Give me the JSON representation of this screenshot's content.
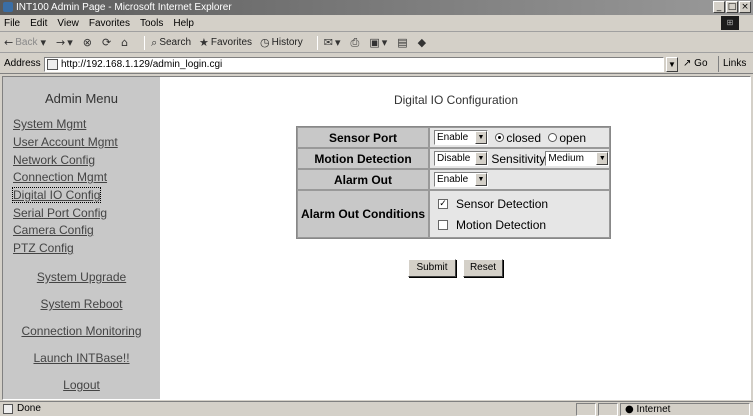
{
  "window": {
    "title": "INT100 Admin Page - Microsoft Internet Explorer",
    "controls": [
      "_",
      "□",
      "×"
    ]
  },
  "menubar": [
    "File",
    "Edit",
    "View",
    "Favorites",
    "Tools",
    "Help"
  ],
  "toolbar": {
    "back": "Back",
    "search": "Search",
    "favorites": "Favorites",
    "history": "History"
  },
  "addressbar": {
    "label": "Address",
    "url": "http://192.168.1.129/admin_login.cgi",
    "go": "Go",
    "links": "Links"
  },
  "sidebar": {
    "title": "Admin Menu",
    "items": [
      {
        "label": "System Mgmt"
      },
      {
        "label": "User Account Mgmt"
      },
      {
        "label": "Network Config"
      },
      {
        "label": "Connection Mgmt"
      },
      {
        "label": "Digital IO Config"
      },
      {
        "label": "Serial Port Config"
      },
      {
        "label": "Camera Config"
      },
      {
        "label": "PTZ Config"
      }
    ],
    "actions": [
      {
        "label": "System Upgrade"
      },
      {
        "label": "System Reboot"
      },
      {
        "label": "Connection Monitoring"
      },
      {
        "label": "Launch INTBase!!"
      },
      {
        "label": "Logout"
      }
    ]
  },
  "main": {
    "title": "Digital IO Configuration",
    "sensor_port": {
      "label": "Sensor Port",
      "value": "Enable",
      "opt_closed": "closed",
      "opt_open": "open"
    },
    "motion": {
      "label": "Motion Detection",
      "value": "Disable",
      "sens_label": "Sensitivity",
      "sens_value": "Medium"
    },
    "alarm_out": {
      "label": "Alarm Out",
      "value": "Enable"
    },
    "conditions": {
      "label": "Alarm Out Conditions",
      "sensor": "Sensor Detection",
      "motion": "Motion Detection"
    },
    "submit": "Submit",
    "reset": "Reset"
  },
  "status": {
    "text": "Done",
    "zone": "Internet"
  }
}
